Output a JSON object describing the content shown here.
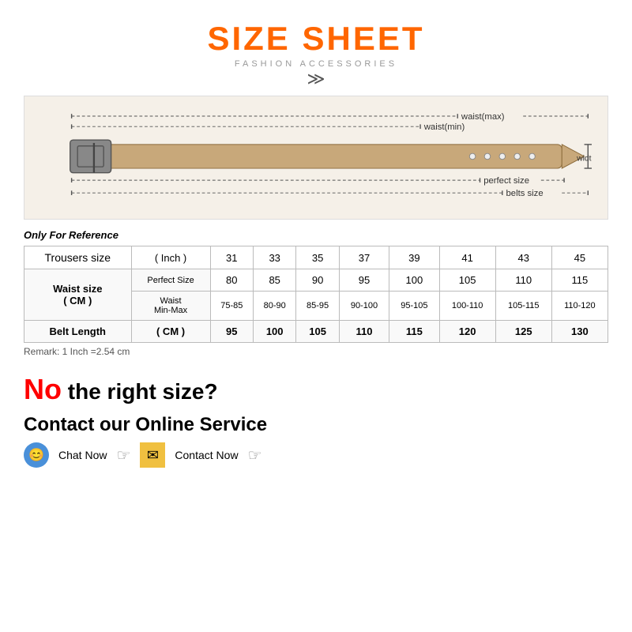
{
  "header": {
    "title": "SIZE SHEET",
    "subtitle": "FASHION ACCESSORIES",
    "chevron": "❯❯"
  },
  "belt_diagram": {
    "labels": {
      "waist_max": "waist(max)",
      "waist_min": "waist(min)",
      "perfect_size": "perfect size",
      "belts_size": "belts size",
      "width": "width"
    }
  },
  "reference_note": "Only For Reference",
  "table": {
    "headers": {
      "trousers_size": "Trousers size",
      "unit": "( Inch )",
      "sizes": [
        "31",
        "33",
        "35",
        "37",
        "39",
        "41",
        "43",
        "45"
      ]
    },
    "waist_label": "Waist size",
    "waist_unit": "( CM )",
    "perfect_label": "Perfect Size",
    "perfect_values": [
      "80",
      "85",
      "90",
      "95",
      "100",
      "105",
      "110",
      "115"
    ],
    "min_max_label": "Waist Min-Max",
    "min_max_values": [
      "75-85",
      "80-90",
      "85-95",
      "90-100",
      "95-105",
      "100-110",
      "105-115",
      "110-120"
    ],
    "belt_label": "Belt Length",
    "belt_unit": "( CM )",
    "belt_values": [
      "95",
      "100",
      "105",
      "110",
      "115",
      "120",
      "125",
      "130"
    ]
  },
  "remark": "Remark: 1 Inch =2.54 cm",
  "no_size": {
    "no": "No",
    "text": "the right size?",
    "contact_label": "Contact our Online Service",
    "chat_now": "Chat Now",
    "contact_now": "Contact Now"
  }
}
